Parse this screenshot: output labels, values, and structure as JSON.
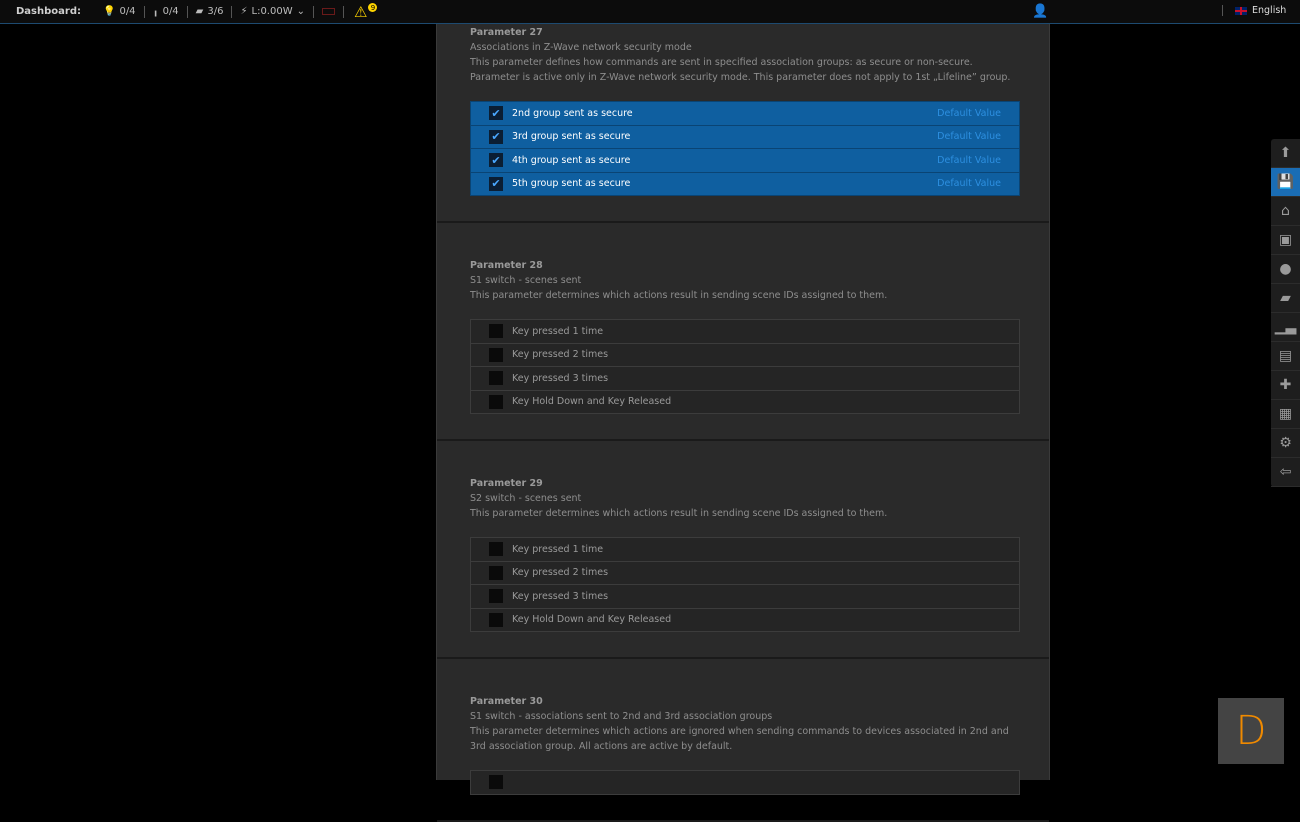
{
  "topbar": {
    "label": "Dashboard:",
    "lights": "0/4",
    "plugs": "0/4",
    "scenes": "3/6",
    "power": "L:0.00W",
    "alerts": "9"
  },
  "language": "English",
  "params": [
    {
      "title": "Parameter 27",
      "subtitle": "Associations in Z-Wave network security mode",
      "desc": "This parameter defines how commands are sent in specified association groups: as secure or non-secure. Parameter is active only in Z-Wave network security mode. This parameter does not apply to 1st „Lifeline” group.",
      "options": [
        {
          "label": "2nd group sent as secure",
          "checked": true,
          "note": "Default Value"
        },
        {
          "label": "3rd group sent as secure",
          "checked": true,
          "note": "Default Value"
        },
        {
          "label": "4th group sent as secure",
          "checked": true,
          "note": "Default Value"
        },
        {
          "label": "5th group sent as secure",
          "checked": true,
          "note": "Default Value"
        }
      ]
    },
    {
      "title": "Parameter 28",
      "subtitle": "S1 switch - scenes sent",
      "desc": "This parameter determines which actions result in sending scene IDs assigned to them.",
      "options": [
        {
          "label": "Key pressed 1 time"
        },
        {
          "label": "Key pressed 2 times"
        },
        {
          "label": "Key pressed 3 times"
        },
        {
          "label": "Key Hold Down and Key Released"
        }
      ]
    },
    {
      "title": "Parameter 29",
      "subtitle": "S2 switch - scenes sent",
      "desc": "This parameter determines which actions result in sending scene IDs assigned to them.",
      "options": [
        {
          "label": "Key pressed 1 time"
        },
        {
          "label": "Key pressed 2 times"
        },
        {
          "label": "Key pressed 3 times"
        },
        {
          "label": "Key Hold Down and Key Released"
        }
      ]
    },
    {
      "title": "Parameter 30",
      "subtitle": "S1 switch - associations sent to 2nd and 3rd association groups",
      "desc": "This parameter determines which actions are ignored when sending commands to devices associated in 2nd and 3rd association group. All actions are active by default.",
      "options": [
        {
          "label": ""
        }
      ]
    }
  ],
  "widget": "D"
}
